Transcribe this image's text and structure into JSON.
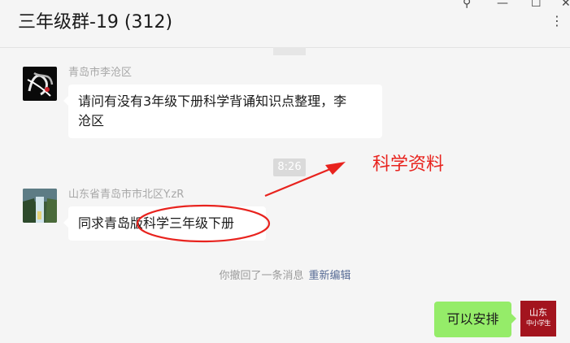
{
  "window": {
    "title": "三年级群-19 (312)",
    "buttons": {
      "pin": "⚲",
      "minimize": "—",
      "maximize": "☐",
      "close": "✕",
      "more": "⋮"
    }
  },
  "messages": [
    {
      "sender": "青岛市李沧区",
      "avatar_icon": "dark-calligraphy-avatar",
      "text_line1": "请问有没有3年级下册科学背诵知识点整理，李",
      "text_line2": "沧区"
    },
    {
      "sender": "山东省青岛市市北区Y.zR",
      "avatar_icon": "waterfall-photo-avatar",
      "text": "同求青岛版科学三年级下册"
    }
  ],
  "time_divider": "8:26",
  "annotation": {
    "label": "科学资料",
    "color": "#e8231e"
  },
  "recall_notice": {
    "text": "你撤回了一条消息",
    "action": "重新编辑"
  },
  "self_message": {
    "text": "可以安排",
    "avatar_line1": "山东",
    "avatar_line2": "中小学生"
  },
  "colors": {
    "background": "#f5f5f5",
    "bubble_in": "#ffffff",
    "bubble_out": "#95ec69",
    "link": "#576b95",
    "self_avatar": "#a3141e"
  }
}
